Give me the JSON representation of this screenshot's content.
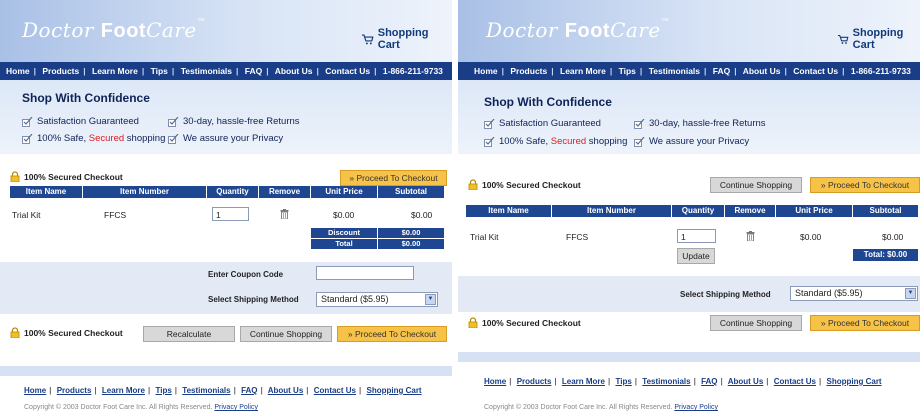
{
  "left": {
    "logo": {
      "part1": "Doctor ",
      "part2": "Foot",
      "part3": "Care",
      "tm": "™"
    },
    "cart_label": "Shopping Cart",
    "nav": [
      {
        "label": "Home"
      },
      {
        "label": "Products"
      },
      {
        "label": "Learn More"
      },
      {
        "label": "Tips"
      },
      {
        "label": "Testimonials"
      },
      {
        "label": "FAQ"
      },
      {
        "label": "About Us"
      },
      {
        "label": "Contact Us"
      },
      {
        "label": "1-866-211-9733"
      }
    ],
    "confidence": {
      "title": "Shop With Confidence",
      "f1": "Satisfaction Guaranteed",
      "f2": "30-day, hassle-free Returns",
      "f3a": "100% Safe, ",
      "f3b": "Secured",
      "f3c": " shopping",
      "f4": "We assure your Privacy"
    },
    "secured_checkout": "100% Secured Checkout",
    "proceed_top": "» Proceed To Checkout",
    "columns": [
      "Item Name",
      "Item Number",
      "Quantity",
      "Remove",
      "Unit Price",
      "Subtotal"
    ],
    "row": {
      "name": "Trial Kit",
      "number": "FFCS",
      "qty": "1",
      "unit_price": "$0.00",
      "subtotal": "$0.00"
    },
    "discount_label": "Discount",
    "discount_value": "$0.00",
    "total_label": "Total",
    "total_value": "$0.00",
    "coupon_label": "Enter Coupon Code",
    "coupon_value": "",
    "shipping_label": "Select Shipping Method",
    "shipping_value": "Standard ($5.95)",
    "secured_checkout_bottom": "100% Secured Checkout",
    "recalculate": "Recalculate",
    "continue_shopping": "Continue Shopping",
    "proceed_bottom": "» Proceed To Checkout",
    "footer_links": [
      {
        "label": "Home"
      },
      {
        "label": "Products"
      },
      {
        "label": "Learn More"
      },
      {
        "label": "Tips"
      },
      {
        "label": "Testimonials"
      },
      {
        "label": "FAQ"
      },
      {
        "label": "About Us"
      },
      {
        "label": "Contact Us"
      },
      {
        "label": "Shopping Cart"
      }
    ],
    "copyright": "Copyright © 2003 Doctor Foot Care Inc. All Rights Reserved.",
    "privacy": "Privacy Policy"
  },
  "right": {
    "logo": {
      "part1": "Doctor ",
      "part2": "Foot",
      "part3": "Care",
      "tm": "™"
    },
    "cart_label": "Shopping Cart",
    "nav": [
      {
        "label": "Home"
      },
      {
        "label": "Products"
      },
      {
        "label": "Learn More"
      },
      {
        "label": "Tips"
      },
      {
        "label": "Testimonials"
      },
      {
        "label": "FAQ"
      },
      {
        "label": "About Us"
      },
      {
        "label": "Contact Us"
      },
      {
        "label": "1-866-211-9733"
      }
    ],
    "confidence": {
      "title": "Shop With Confidence",
      "f1": "Satisfaction Guaranteed",
      "f2": "30-day, hassle-free Returns",
      "f3a": "100% Safe, ",
      "f3b": "Secured",
      "f3c": " shopping",
      "f4": "We assure your Privacy"
    },
    "secured_checkout": "100% Secured Checkout",
    "continue_top": "Continue Shopping",
    "proceed_top": "» Proceed To Checkout",
    "columns": [
      "Item Name",
      "Item Number",
      "Quantity",
      "Remove",
      "Unit Price",
      "Subtotal"
    ],
    "row": {
      "name": "Trial Kit",
      "number": "FFCS",
      "qty": "1",
      "unit_price": "$0.00",
      "subtotal": "$0.00"
    },
    "update": "Update",
    "total": "Total: $0.00",
    "shipping_label": "Select Shipping Method",
    "shipping_value": "Standard ($5.95)",
    "secured_checkout_bottom": "100% Secured Checkout",
    "continue_bottom": "Continue Shopping",
    "proceed_bottom": "» Proceed To Checkout",
    "footer_links": [
      {
        "label": "Home"
      },
      {
        "label": "Products"
      },
      {
        "label": "Learn More"
      },
      {
        "label": "Tips"
      },
      {
        "label": "Testimonials"
      },
      {
        "label": "FAQ"
      },
      {
        "label": "About Us"
      },
      {
        "label": "Contact Us"
      },
      {
        "label": "Shopping Cart"
      }
    ],
    "copyright": "Copyright © 2003 Doctor Foot Care Inc. All Rights Reserved.",
    "privacy": "Privacy Policy"
  }
}
